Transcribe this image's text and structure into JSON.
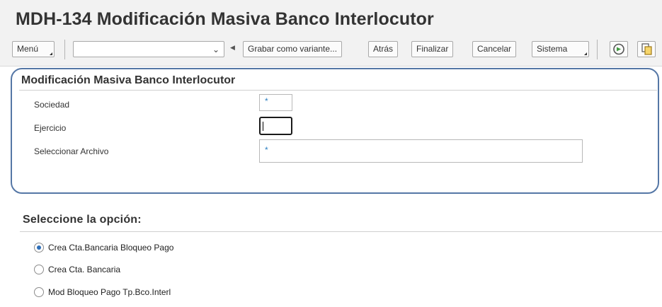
{
  "app": {
    "title": "MDH-134 Modificación Masiva Banco Interlocutor"
  },
  "toolbar": {
    "menu_label": "Menú",
    "variant_value": "",
    "save_variant_label": "Grabar como variante...",
    "back_label": "Atrás",
    "finish_label": "Finalizar",
    "cancel_label": "Cancelar",
    "system_label": "Sistema",
    "icons": [
      "execute-icon",
      "copy-icon"
    ]
  },
  "form": {
    "title": "Modificación Masiva Banco Interlocutor",
    "company_label": "Sociedad",
    "company_value": "*",
    "year_label": "Ejercicio",
    "year_value": "",
    "file_label": "Seleccionar Archivo",
    "file_value": "*"
  },
  "options": {
    "title": "Seleccione la opción:",
    "items": [
      {
        "label": "Crea Cta.Bancaria Bloqueo Pago",
        "selected": true
      },
      {
        "label": "Crea Cta. Bancaria",
        "selected": false
      },
      {
        "label": "Mod Bloqueo Pago Tp.Bco.Interl",
        "selected": false
      }
    ]
  },
  "colors": {
    "focus_ring": "#5577a6",
    "radio_selected": "#2d6eb8",
    "required_marker": "#2d7fc1"
  }
}
